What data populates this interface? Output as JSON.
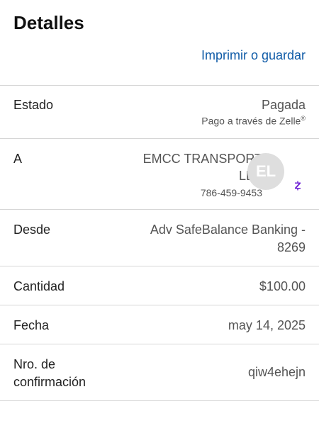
{
  "header": {
    "title": "Detalles",
    "print_link": "Imprimir o guardar"
  },
  "rows": {
    "status": {
      "label": "Estado",
      "value": "Pagada",
      "sub": "Pago a través de Zelle",
      "sup": "®"
    },
    "to": {
      "label": "A",
      "name_line1": "EMCC TRANSPORT",
      "name_line2": "LLC",
      "phone": "786-459-9453",
      "avatar_initials": "EL"
    },
    "from": {
      "label": "Desde",
      "line1": "Adv SafeBalance Banking -",
      "line2": "8269"
    },
    "amount": {
      "label": "Cantidad",
      "value": "$100.00"
    },
    "date": {
      "label": "Fecha",
      "value": "may 14, 2025"
    },
    "confirmation": {
      "label_line1": "Nro. de",
      "label_line2": "confirmación",
      "value": "qiw4ehejn"
    }
  },
  "colors": {
    "link": "#0f5ba7",
    "zelle_purple": "#6d1ed4"
  },
  "icons": {
    "zelle_badge": "zelle-icon"
  }
}
